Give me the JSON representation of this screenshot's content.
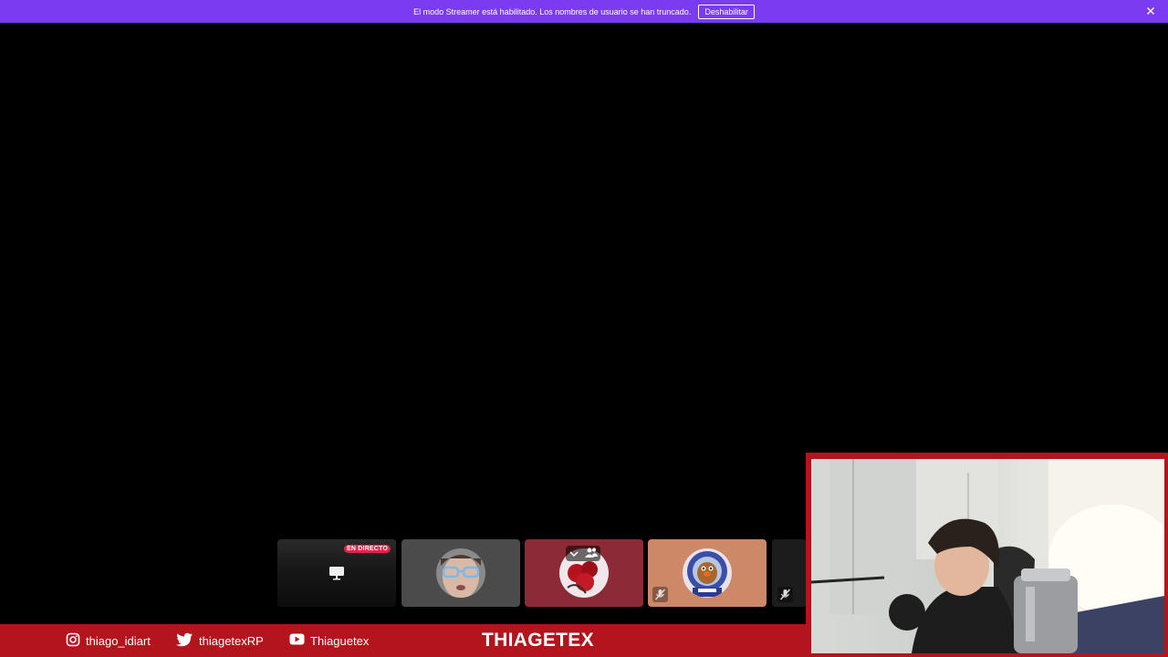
{
  "streamer_banner": {
    "message": "El modo Streamer está habilitado. Los nombres de usuario se han truncado.",
    "disable_button": "Deshabilitar",
    "close_icon": "close-icon"
  },
  "voice_tiles": [
    {
      "type": "screen-share",
      "badge": "EN DIRECTO",
      "icon": "monitor-icon"
    },
    {
      "type": "participant",
      "avatar": "child-avatar"
    },
    {
      "type": "participant",
      "avatar": "roses-avatar",
      "controls": [
        "chevron-down-icon",
        "people-icon"
      ]
    },
    {
      "type": "participant",
      "avatar": "potato-astronaut-avatar",
      "status_icon": "mic-muted-icon"
    },
    {
      "type": "participant",
      "status_icon": "mic-muted-icon"
    }
  ],
  "overlay": {
    "socials": [
      {
        "icon": "instagram-icon",
        "handle": "thiago_idiart"
      },
      {
        "icon": "twitter-icon",
        "handle": "thiagetexRP"
      },
      {
        "icon": "youtube-icon",
        "handle": "Thiaguetex"
      }
    ],
    "brand": "THIAGETEX"
  },
  "colors": {
    "banner": "#7b3bf0",
    "overlay_red": "#b4141b",
    "live_badge": "#e0254b"
  }
}
